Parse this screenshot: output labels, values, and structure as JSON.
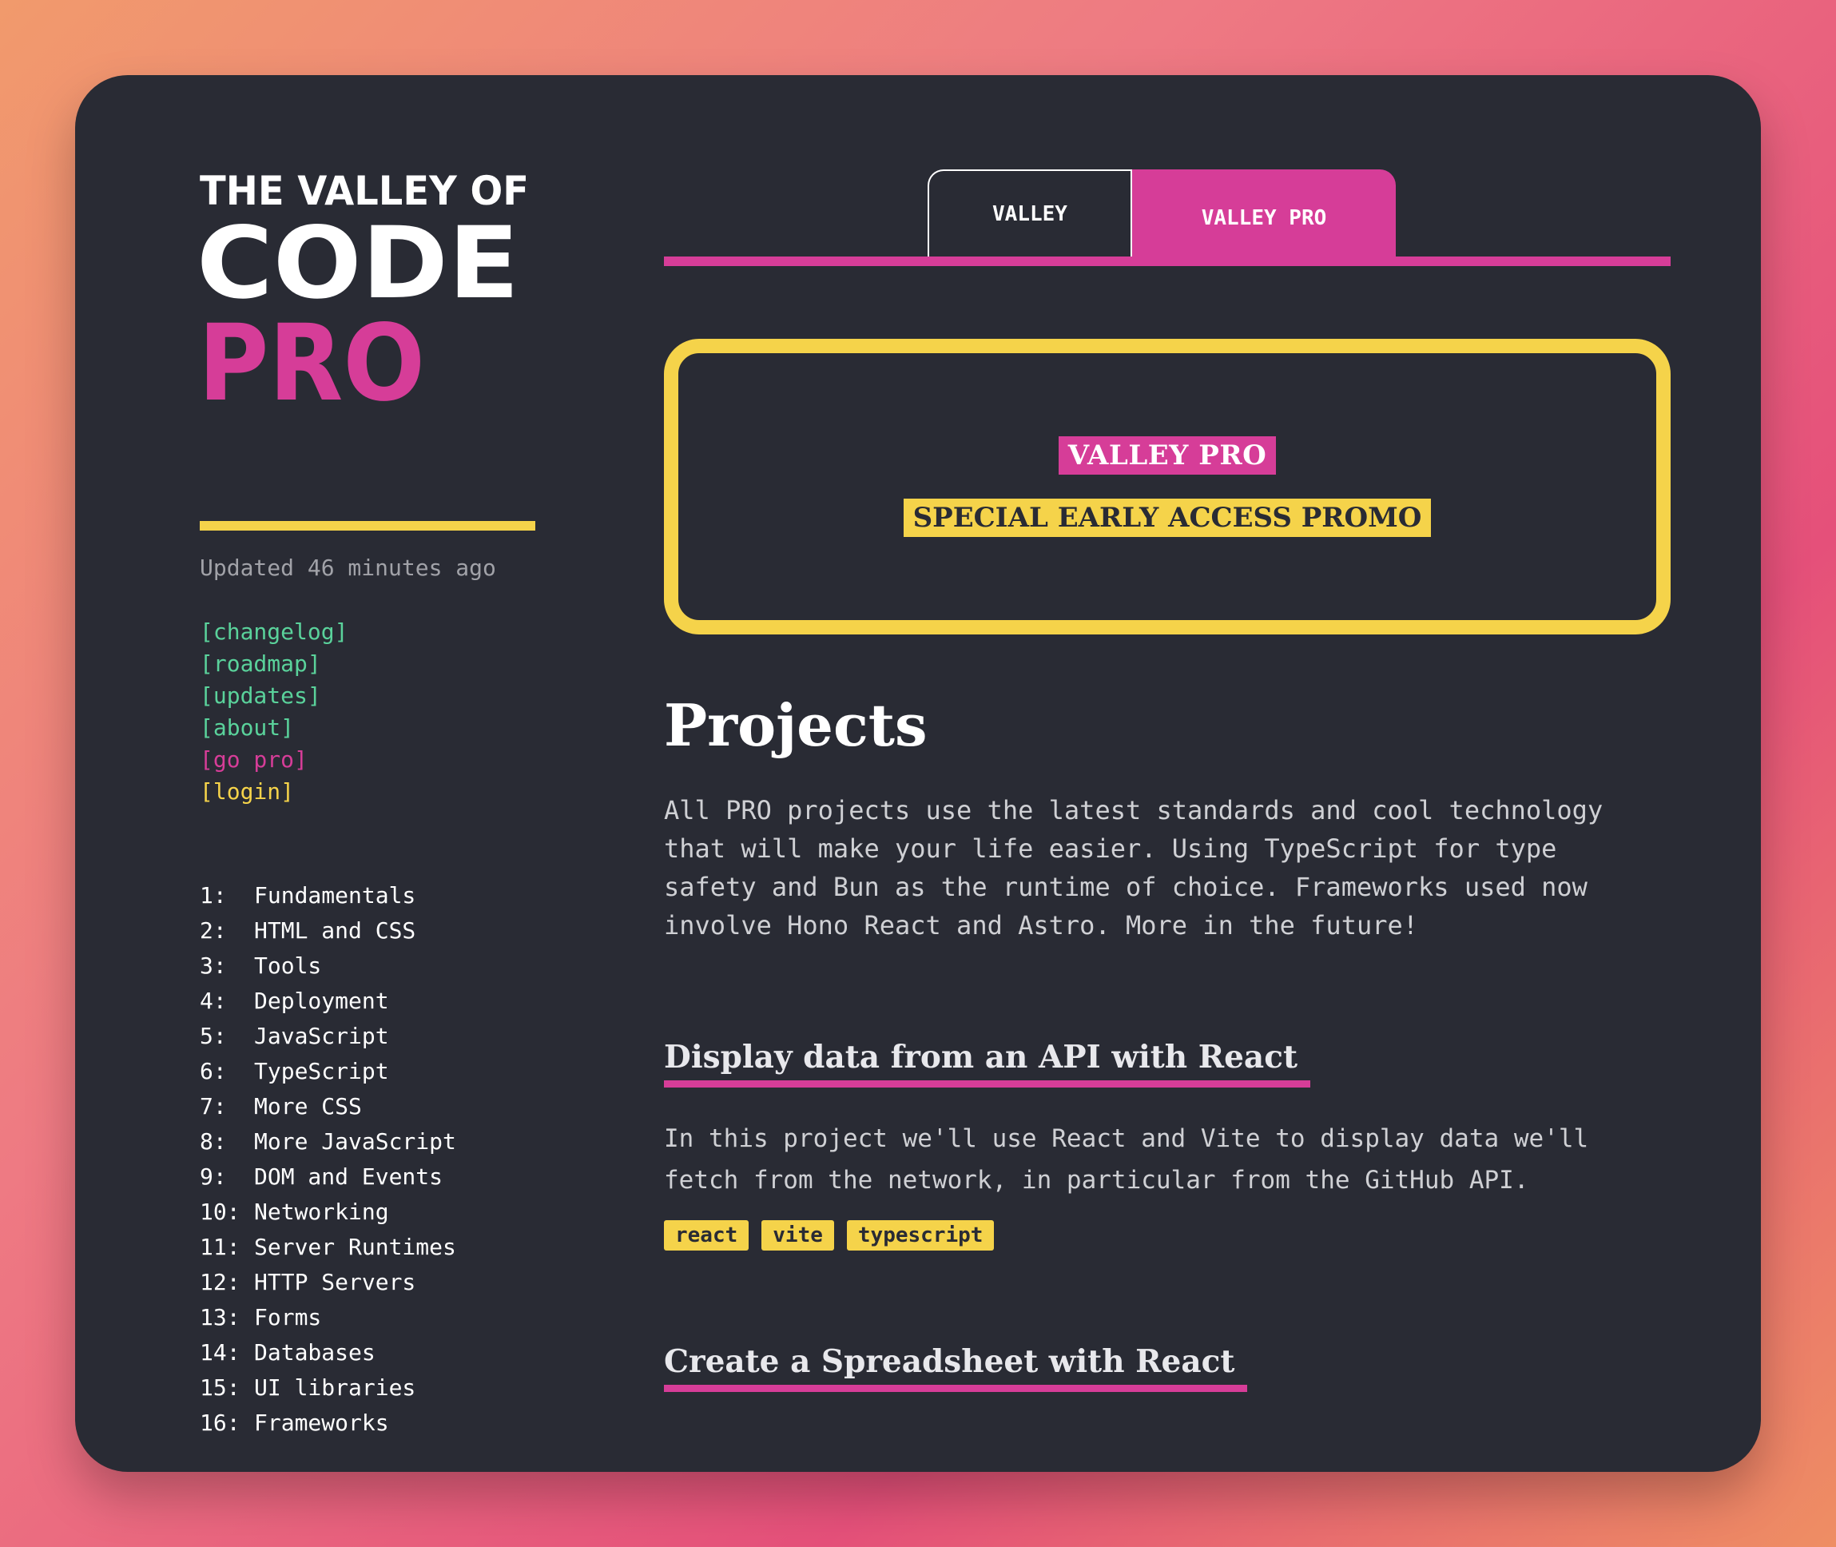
{
  "logo": {
    "line1": "THE VALLEY OF",
    "line2": "CODE",
    "line3": "PRO"
  },
  "sidebar": {
    "updated": "Updated 46 minutes ago",
    "links": [
      {
        "label": "[changelog]",
        "color": "#5ad29b"
      },
      {
        "label": "[roadmap]",
        "color": "#5ad29b"
      },
      {
        "label": "[updates]",
        "color": "#5ad29b"
      },
      {
        "label": "[about]",
        "color": "#5ad29b"
      },
      {
        "label": "[go pro]",
        "color": "#d63d98"
      },
      {
        "label": "[login]",
        "color": "#f5d34a"
      }
    ],
    "toc": [
      {
        "num": "1:",
        "label": "Fundamentals"
      },
      {
        "num": "2:",
        "label": "HTML and CSS"
      },
      {
        "num": "3:",
        "label": "Tools"
      },
      {
        "num": "4:",
        "label": "Deployment"
      },
      {
        "num": "5:",
        "label": "JavaScript"
      },
      {
        "num": "6:",
        "label": "TypeScript"
      },
      {
        "num": "7:",
        "label": "More CSS"
      },
      {
        "num": "8:",
        "label": "More JavaScript"
      },
      {
        "num": "9:",
        "label": "DOM and Events"
      },
      {
        "num": "10:",
        "label": "Networking"
      },
      {
        "num": "11:",
        "label": "Server Runtimes"
      },
      {
        "num": "12:",
        "label": "HTTP Servers"
      },
      {
        "num": "13:",
        "label": "Forms"
      },
      {
        "num": "14:",
        "label": "Databases"
      },
      {
        "num": "15:",
        "label": "UI libraries"
      },
      {
        "num": "16:",
        "label": "Frameworks"
      }
    ]
  },
  "tabs": {
    "valley": "VALLEY",
    "pro": "VALLEY PRO"
  },
  "promo": {
    "badge": "VALLEY PRO",
    "text": "SPECIAL EARLY ACCESS PROMO"
  },
  "main": {
    "title": "Projects",
    "intro": "All PRO projects use the latest standards and cool technology that will make your life easier. Using TypeScript for type safety and Bun as the runtime of choice. Frameworks used now involve Hono React and Astro. More in the future!",
    "projects": [
      {
        "title": "Display data from an API with React",
        "desc": "In this project we'll use React and Vite to display data we'll fetch from the network, in particular from the GitHub API.",
        "tags": [
          "react",
          "vite",
          "typescript"
        ]
      },
      {
        "title": "Create a Spreadsheet with React"
      }
    ]
  },
  "colors": {
    "pink": "#d63d98",
    "yellow": "#f5d34a",
    "green": "#5ad29b",
    "background": "#292b34"
  }
}
